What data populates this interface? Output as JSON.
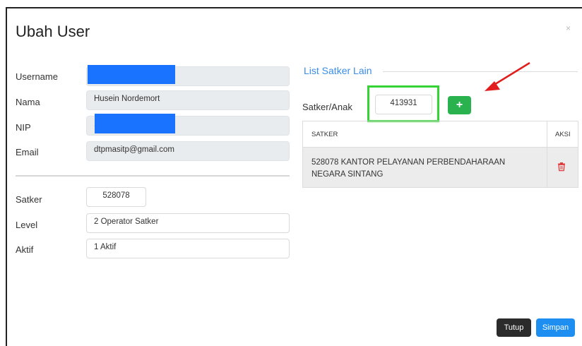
{
  "modal": {
    "title": "Ubah User",
    "close_icon": "×"
  },
  "form": {
    "username_label": "Username",
    "nama_label": "Nama",
    "nama_value": "Husein Nordemort",
    "nip_label": "NIP",
    "nip_partial": "1",
    "email_label": "Email",
    "email_value": "dtpmasitp@gmail.com",
    "satker_label": "Satker",
    "satker_value": "528078",
    "level_label": "Level",
    "level_value": "2 Operator Satker",
    "aktif_label": "Aktif",
    "aktif_value": "1 Aktif"
  },
  "satker_list": {
    "title": "List Satker Lain",
    "anak_label": "Satker/Anak",
    "anak_value": "413931",
    "add_icon": "+",
    "columns": [
      "SATKER",
      "AKSI"
    ],
    "rows": [
      {
        "satker": "528078 KANTOR PELAYANAN PERBENDAHARAAN NEGARA SINTANG"
      }
    ]
  },
  "footer": {
    "close_label": "Tutup",
    "save_label": "Simpan"
  },
  "colors": {
    "accent": "#3a8ee6",
    "add_button": "#2ab24e",
    "highlight": "#35d335",
    "annotation_arrow": "#e11d1d",
    "redaction": "#1a73ff",
    "delete_icon": "#e03b3b"
  }
}
